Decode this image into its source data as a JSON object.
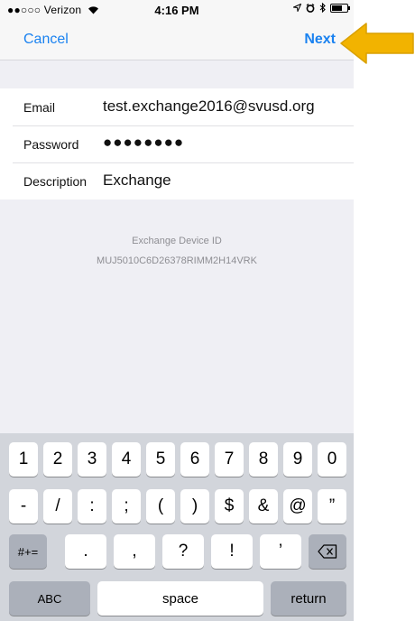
{
  "status": {
    "carrier": "●●○○○ Verizon",
    "wifi_icon": "wifi-icon",
    "time": "4:16 PM",
    "right_icons": [
      "location-icon",
      "alarm-icon",
      "bluetooth-icon",
      "battery-icon"
    ]
  },
  "nav": {
    "cancel_label": "Cancel",
    "next_label": "Next"
  },
  "form": {
    "rows": [
      {
        "label": "Email",
        "value": "test.exchange2016@svusd.org"
      },
      {
        "label": "Password",
        "value": "●●●●●●●●"
      },
      {
        "label": "Description",
        "value": "Exchange"
      }
    ]
  },
  "device": {
    "title": "Exchange Device ID",
    "id": "MUJ5010C6D26378RIMM2H14VRK"
  },
  "keyboard": {
    "row1": [
      "1",
      "2",
      "3",
      "4",
      "5",
      "6",
      "7",
      "8",
      "9",
      "0"
    ],
    "row2": [
      "-",
      "/",
      ":",
      ";",
      "(",
      ")",
      "$",
      "&",
      "@",
      "”"
    ],
    "row3": {
      "symbols": "#+=",
      "keys": [
        ".",
        ",",
        "?",
        "!",
        "’"
      ],
      "delete_icon": "backspace-icon"
    },
    "row4": {
      "abc": "ABC",
      "space": "space",
      "return": "return"
    }
  },
  "annotation": {
    "arrow_color": "#f2b300",
    "arrow_icon": "arrow-left-icon"
  }
}
